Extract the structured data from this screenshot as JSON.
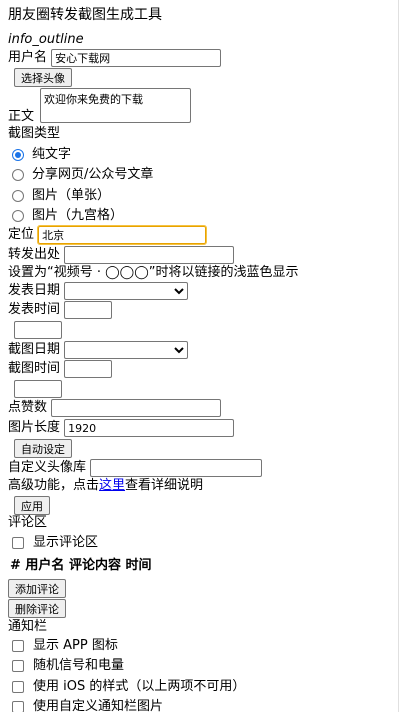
{
  "page": {
    "title": "朋友圈转发截图生成工具",
    "icon_name": "info_outline"
  },
  "form": {
    "username_label": "用户名",
    "username_value": "安心下载网",
    "avatar_button": "选择头像",
    "body_label": "正文",
    "body_value": "欢迎你来免费的下载",
    "type_label": "截图类型",
    "types": [
      "纯文字",
      "分享网页/公众号文章",
      "图片（单张）",
      "图片（九宫格）"
    ],
    "location_label": "定位",
    "location_value": "北京",
    "forward_label": "转发出处",
    "forward_value": "",
    "video_hint": "设置为“视频号 · ◯◯◯”时将以链接的浅蓝色显示",
    "pub_date_label": "发表日期",
    "pub_time_label": "发表时间",
    "shot_date_label": "截图日期",
    "shot_time_label": "截图时间",
    "likes_label": "点赞数",
    "likes_value": "",
    "img_len_label": "图片长度",
    "img_len_value": "1920",
    "auto_button": "自动设定",
    "avatar_lib_label": "自定义头像库",
    "avatar_lib_value": "",
    "advanced_prefix": "高级功能，点击",
    "advanced_link": "这里",
    "advanced_suffix": "查看详细说明",
    "apply_button": "应用"
  },
  "comments": {
    "section_label": "评论区",
    "show_label": "显示评论区",
    "header": "# 用户名 评论内容 时间",
    "add_button": "添加评论",
    "delete_button": "删除评论"
  },
  "notify": {
    "section_label": "通知栏",
    "opts": [
      "显示 APP 图标",
      "随机信号和电量",
      "使用 iOS 的样式（以上两项不可用）",
      "使用自定义通知栏图片"
    ]
  }
}
